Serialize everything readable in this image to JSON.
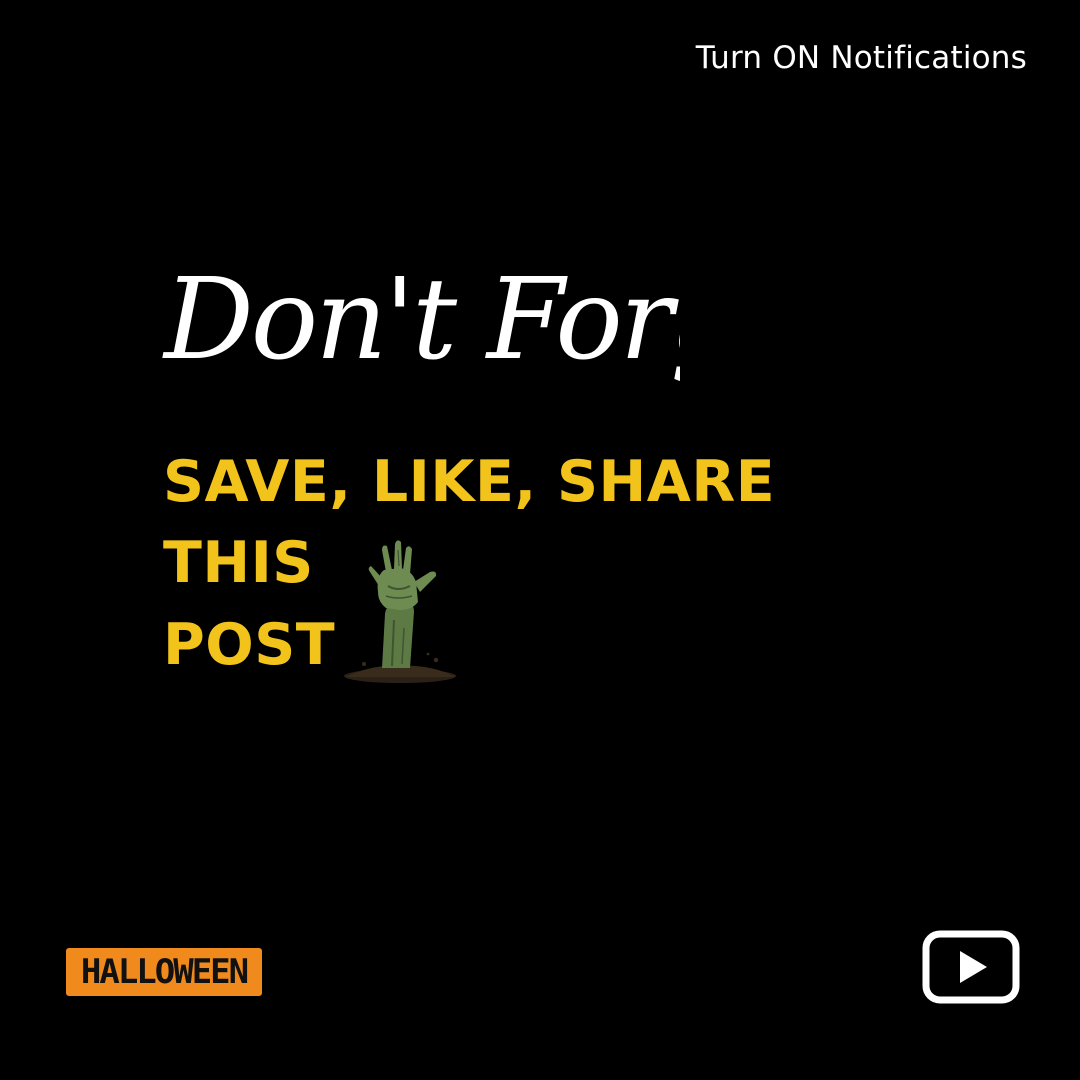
{
  "header": {
    "notification_text": "Turn ON Notifications"
  },
  "main": {
    "script_heading": "Don't Forget to",
    "cta_lines": [
      "SAVE, LIKE, SHARE",
      "THIS",
      "POST"
    ],
    "hand_icon": "zombie-hand-icon"
  },
  "footer": {
    "badge_text": "HALLOWEEN",
    "play_icon": "play-button-icon"
  },
  "colors": {
    "background": "#000000",
    "cta": "#f2c31b",
    "badge": "#f08a1c",
    "text": "#ffffff"
  }
}
